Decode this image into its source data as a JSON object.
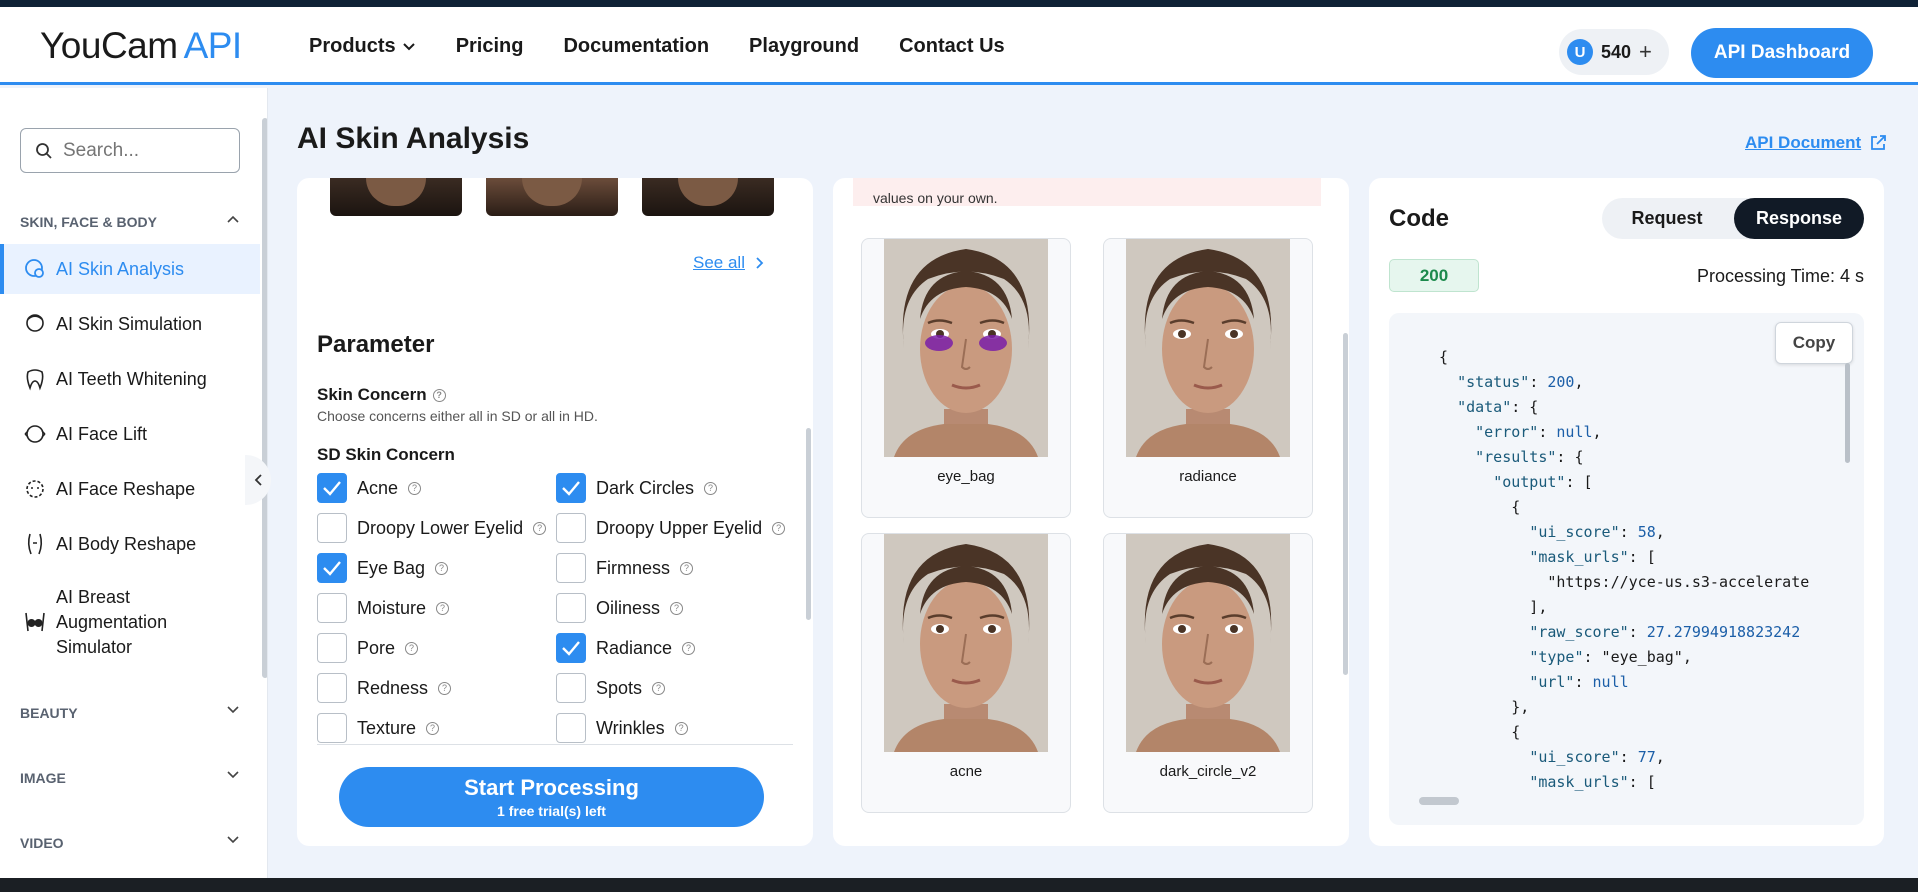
{
  "header": {
    "logo_main": "YouCam",
    "logo_accent": "API",
    "nav": [
      "Products",
      "Pricing",
      "Documentation",
      "Playground",
      "Contact Us"
    ],
    "credits": "540",
    "credits_icon": "U",
    "api_dashboard": "API Dashboard"
  },
  "sidebar": {
    "search_placeholder": "Search...",
    "section_skin": "SKIN, FACE & BODY",
    "items": [
      {
        "label": "AI Skin Analysis",
        "icon": "skin-analysis-icon"
      },
      {
        "label": "AI Skin Simulation",
        "icon": "skin-simulation-icon"
      },
      {
        "label": "AI Teeth Whitening",
        "icon": "tooth-icon"
      },
      {
        "label": "AI Face Lift",
        "icon": "face-lift-icon"
      },
      {
        "label": "AI Face Reshape",
        "icon": "face-reshape-icon"
      },
      {
        "label": "AI Body Reshape",
        "icon": "body-reshape-icon"
      },
      {
        "label": "AI Breast Augmentation Simulator",
        "icon": "breast-icon"
      }
    ],
    "section_beauty": "BEAUTY",
    "section_image": "IMAGE",
    "section_video": "VIDEO"
  },
  "main": {
    "title": "AI Skin Analysis",
    "api_document": "API Document"
  },
  "params_panel": {
    "see_all": "See all",
    "parameter_title": "Parameter",
    "skin_concern": "Skin Concern",
    "skin_concern_hint": "Choose concerns either all in SD or all in HD.",
    "sd_title": "SD Skin Concern",
    "concerns": [
      {
        "label": "Acne",
        "checked": true
      },
      {
        "label": "Dark Circles",
        "checked": true
      },
      {
        "label": "Droopy Lower Eyelid",
        "checked": false
      },
      {
        "label": "Droopy Upper Eyelid",
        "checked": false
      },
      {
        "label": "Eye Bag",
        "checked": true
      },
      {
        "label": "Firmness",
        "checked": false
      },
      {
        "label": "Moisture",
        "checked": false
      },
      {
        "label": "Oiliness",
        "checked": false
      },
      {
        "label": "Pore",
        "checked": false
      },
      {
        "label": "Radiance",
        "checked": true
      },
      {
        "label": "Redness",
        "checked": false
      },
      {
        "label": "Spots",
        "checked": false
      },
      {
        "label": "Texture",
        "checked": false
      },
      {
        "label": "Wrinkles",
        "checked": false
      }
    ],
    "start_label": "Start Processing",
    "trials_label": "1 free trial(s) left"
  },
  "results_panel": {
    "notice": "values on your own.",
    "cards": [
      "eye_bag",
      "radiance",
      "acne",
      "dark_circle_v2"
    ]
  },
  "code_panel": {
    "title": "Code",
    "request_tab": "Request",
    "response_tab": "Response",
    "status_code": "200",
    "processing_time": "Processing Time: 4 s",
    "copy_label": "Copy",
    "lines": [
      "{",
      "  \"status\": 200,",
      "  \"data\": {",
      "    \"error\": null,",
      "    \"results\": {",
      "      \"output\": [",
      "        {",
      "          \"ui_score\": 58,",
      "          \"mask_urls\": [",
      "            \"https://yce-us.s3-accelerate",
      "          ],",
      "          \"raw_score\": 27.27994918823242",
      "          \"type\": \"eye_bag\",",
      "          \"url\": null",
      "        },",
      "        {",
      "          \"ui_score\": 77,",
      "          \"mask_urls\": ["
    ]
  },
  "colors": {
    "accent": "#2d8cf0",
    "dark": "#111a26",
    "success": "#1c8a4c",
    "eye_bag_overlay": "#7a1fa8"
  }
}
